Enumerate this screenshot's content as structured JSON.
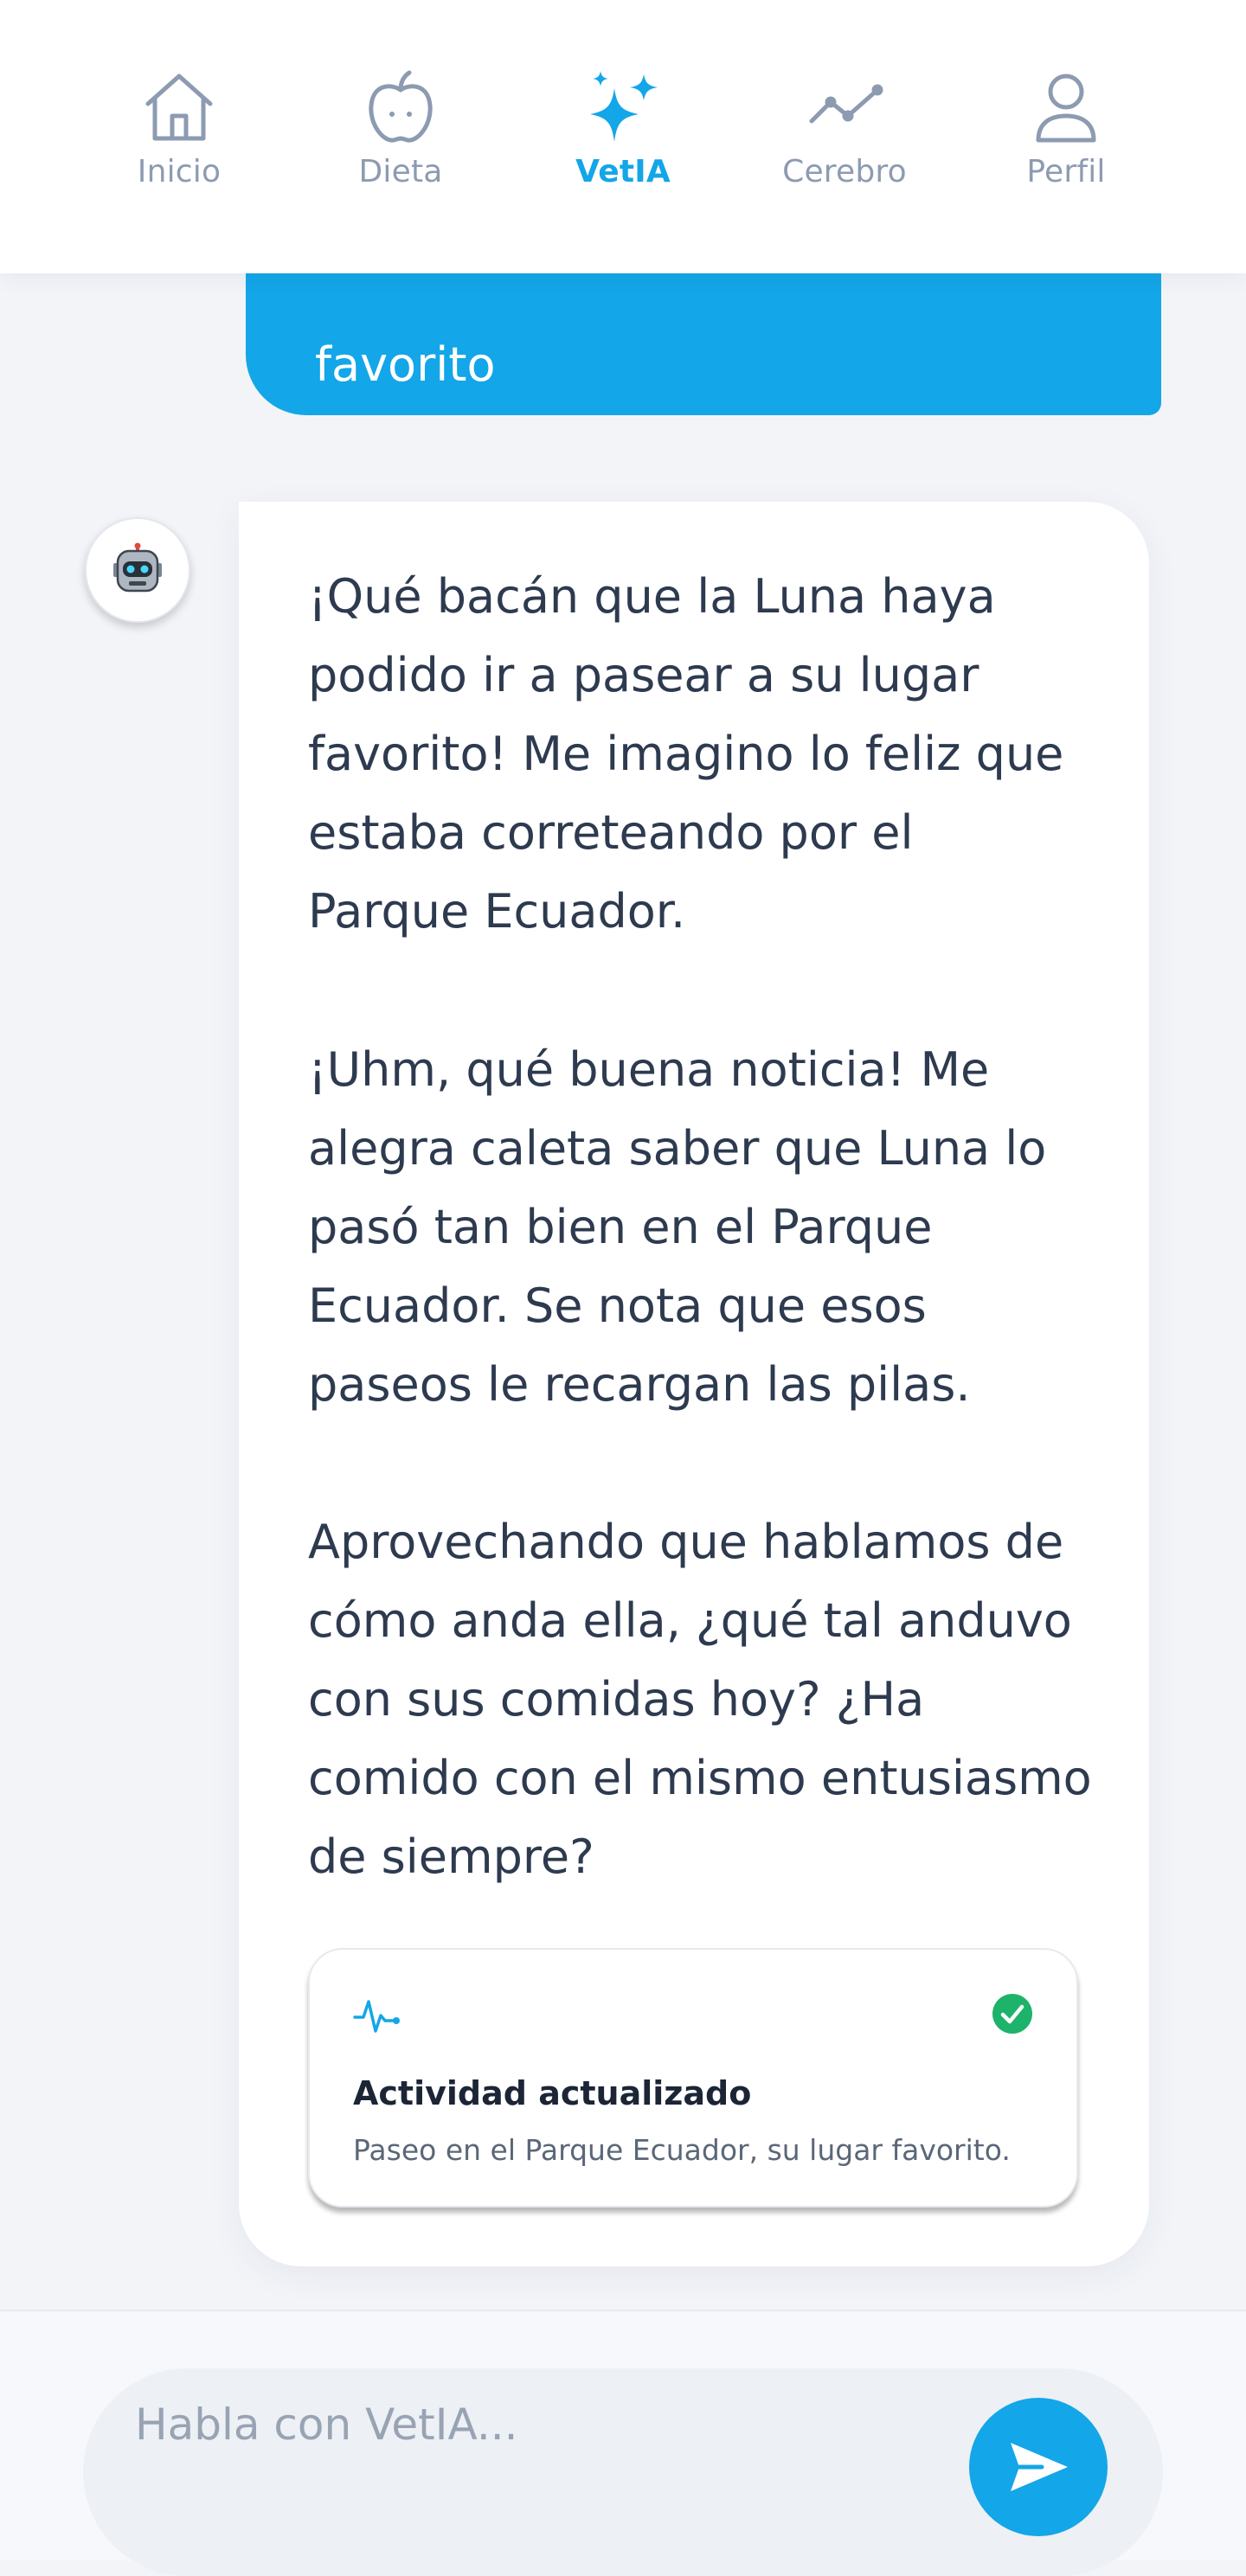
{
  "nav": {
    "items": [
      {
        "label": "Inicio",
        "icon": "home-icon",
        "active": false
      },
      {
        "label": "Dieta",
        "icon": "apple-icon",
        "active": false
      },
      {
        "label": "VetIA",
        "icon": "sparkles-icon",
        "active": true
      },
      {
        "label": "Cerebro",
        "icon": "trend-line-icon",
        "active": false
      },
      {
        "label": "Perfil",
        "icon": "user-icon",
        "active": false
      }
    ]
  },
  "chat": {
    "user_message_tail": "favorito",
    "bot_avatar_icon": "robot-icon",
    "bot_message": {
      "paragraphs": [
        [
          "¡Qué bacán que la Luna haya",
          "podido ir a pasear a su lugar",
          "favorito! Me imagino lo feliz que",
          "estaba correteando por el",
          "Parque Ecuador."
        ],
        [
          "¡Uhm, qué buena noticia! Me",
          "alegra caleta saber que Luna lo",
          "pasó tan bien en el Parque",
          "Ecuador. Se nota que esos",
          "paseos le recargan las pilas."
        ],
        [
          "Aprovechando que hablamos de",
          "cómo anda ella, ¿qué tal anduvo",
          "con sus comidas hoy? ¿Ha",
          "comido con el mismo entusiasmo",
          "de siempre?"
        ]
      ]
    },
    "status_card": {
      "icon": "activity-pulse-icon",
      "status_icon": "check-circle-icon",
      "title": "Actividad actualizado",
      "description": "Paseo en el Parque Ecuador, su lugar favorito."
    }
  },
  "composer": {
    "placeholder": "Habla con VetIA...",
    "value": "",
    "send_icon": "send-icon"
  },
  "colors": {
    "accent": "#13a6e8",
    "nav_inactive": "#8d9bb1",
    "text": "#2d3a4f",
    "success": "#1db36b",
    "background": "#f2f4f8"
  }
}
